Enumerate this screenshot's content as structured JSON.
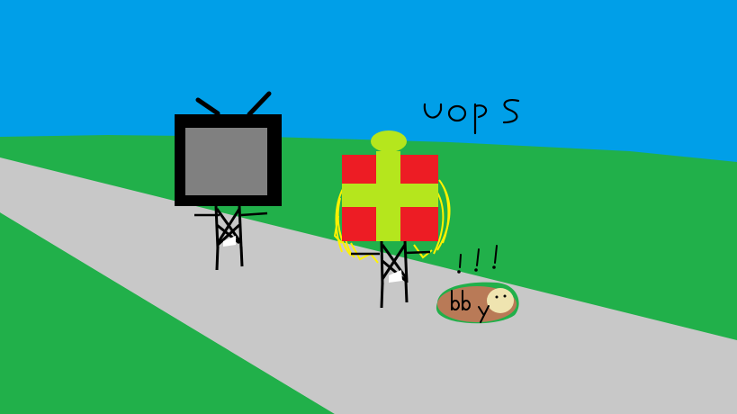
{
  "scene": {
    "caption_oops": "uops",
    "caption_bby": "bby",
    "caption_exclaim": "!!!"
  },
  "colors": {
    "sky": "#009FE8",
    "grass": "#21B04A",
    "road": "#C8C8C8",
    "tv_screen": "#808080",
    "tv_frame": "#000000",
    "gift_box": "#ED1C24",
    "gift_ribbon": "#B5E61D",
    "gift_glow": "#FFF200",
    "blob_body": "#B97A57",
    "blob_face": "#EFE4B0"
  },
  "icons": {
    "tv_character": "tv-head-figure",
    "gift_character": "gift-box-figure",
    "fallen_character": "squashed-blob"
  }
}
